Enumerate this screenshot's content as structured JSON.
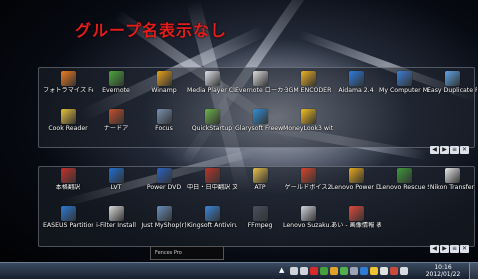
{
  "overlay_title": "グループ名表示なし",
  "fence_1": {
    "icons": [
      {
        "label": "フォトラマイズ Fences",
        "icon": "fences-icon",
        "color": "#f07d1e"
      },
      {
        "label": "Evernote",
        "icon": "evernote-icon",
        "color": "#4aa83c"
      },
      {
        "label": "Winamp",
        "icon": "winamp-icon",
        "color": "#e8a21c"
      },
      {
        "label": "Media Player Classic - Ho...",
        "icon": "media-player-icon",
        "color": "#dfe3ea"
      },
      {
        "label": "Evernote ローカー 位取り替え.cot",
        "icon": "document-icon",
        "color": "#dcdcdc"
      },
      {
        "label": "3GM ENCODER",
        "icon": "encoder-icon",
        "color": "#efb223"
      },
      {
        "label": "Aidama 2.4",
        "icon": "aidama-icon",
        "color": "#2b7de0"
      },
      {
        "label": "My Computer Manager",
        "icon": "computer-manager-icon",
        "color": "#3b7fd6"
      },
      {
        "label": "Easy Duplicate Finder",
        "icon": "duplicate-finder-icon",
        "color": "#5da5e8"
      },
      {
        "label": "Cook Reader",
        "icon": "reader-icon",
        "color": "#e8c23a"
      },
      {
        "label": "ナードア",
        "icon": "app-icon",
        "color": "#c44f2a"
      },
      {
        "label": "Focus",
        "icon": "focus-icon",
        "color": "#7a92b3"
      },
      {
        "label": "QuickStartup",
        "icon": "quickstartup-icon",
        "color": "#6bb34a"
      },
      {
        "label": "Glarysoft Freeware",
        "icon": "glarysoft-icon",
        "color": "#2f8fd6"
      },
      {
        "label": "MoneyLook3 with Yaho...",
        "icon": "moneylook-icon",
        "color": "#f4c01f"
      }
    ],
    "nav": [
      "◀",
      "▶",
      "≡",
      "✕"
    ]
  },
  "fence_2": {
    "icons": [
      {
        "label": "本格翻訳",
        "icon": "translate-icon",
        "color": "#c8302c"
      },
      {
        "label": "LVT",
        "icon": "lvt-icon",
        "color": "#1f6fd1"
      },
      {
        "label": "Power DVD",
        "icon": "power-dvd-icon",
        "color": "#2a63c2"
      },
      {
        "label": "中日・日中翻訳 文",
        "icon": "dictionary-icon",
        "color": "#b7352a"
      },
      {
        "label": "ATP",
        "icon": "folder-icon",
        "color": "#e9c24a"
      },
      {
        "label": "ゲールドボイス2",
        "icon": "voice-icon",
        "color": "#d8452b"
      },
      {
        "label": "Lenovo Power DVD 9",
        "icon": "lenovo-dvd-icon",
        "color": "#e6a91c"
      },
      {
        "label": "Lenovo Rescue System",
        "icon": "rescue-icon",
        "color": "#3f9a3a"
      },
      {
        "label": "Nikon Transfer",
        "icon": "nikon-icon",
        "color": "#e8e8e8"
      },
      {
        "label": "EASEUS Partition Mast...",
        "icon": "partition-icon",
        "color": "#2b7ad6"
      },
      {
        "label": "i-Filter Install",
        "icon": "filter-icon",
        "color": "#d9d9d9"
      },
      {
        "label": "Just MyShop(r)",
        "icon": "myshop-icon",
        "color": "#6a8fbf"
      },
      {
        "label": "Kingsoft Antivirus",
        "icon": "kingsoft-icon",
        "color": "#3b86d9"
      },
      {
        "label": "FFmpeg",
        "icon": "ffmpeg-icon",
        "color": "#4a4f60"
      },
      {
        "label": "Lenovo Suzaku...",
        "icon": "lenovo-icon",
        "color": "#d0d4dd"
      },
      {
        "label": "あい - 画像情報 表示操作 H23",
        "icon": "image-info-icon",
        "color": "#e24a3a"
      }
    ],
    "nav": [
      "◀",
      "▶",
      "≡",
      "✕"
    ]
  },
  "preview_strip": "Fences Pro",
  "taskbar": {
    "clock_time": "10:16",
    "clock_date": "2012/01/22",
    "tray_icons": [
      {
        "icon": "network-icon",
        "color": "#d0d4da"
      },
      {
        "icon": "volume-icon",
        "color": "#d0d4da"
      },
      {
        "icon": "antivirus-icon",
        "color": "#d72b2b"
      },
      {
        "icon": "evernote-tray-icon",
        "color": "#43a03a"
      },
      {
        "icon": "update-icon",
        "color": "#e0a22a"
      },
      {
        "icon": "power-icon",
        "color": "#52b04a"
      },
      {
        "icon": "drive-icon",
        "color": "#9aa4b4"
      },
      {
        "icon": "sync-icon",
        "color": "#2f7cd6"
      },
      {
        "icon": "chat-icon",
        "color": "#f0c330"
      },
      {
        "icon": "flag-icon",
        "color": "#e0e0e0"
      },
      {
        "icon": "ime-icon",
        "color": "#c84a3a"
      },
      {
        "icon": "battery-icon",
        "color": "#d8dbe0"
      }
    ]
  }
}
